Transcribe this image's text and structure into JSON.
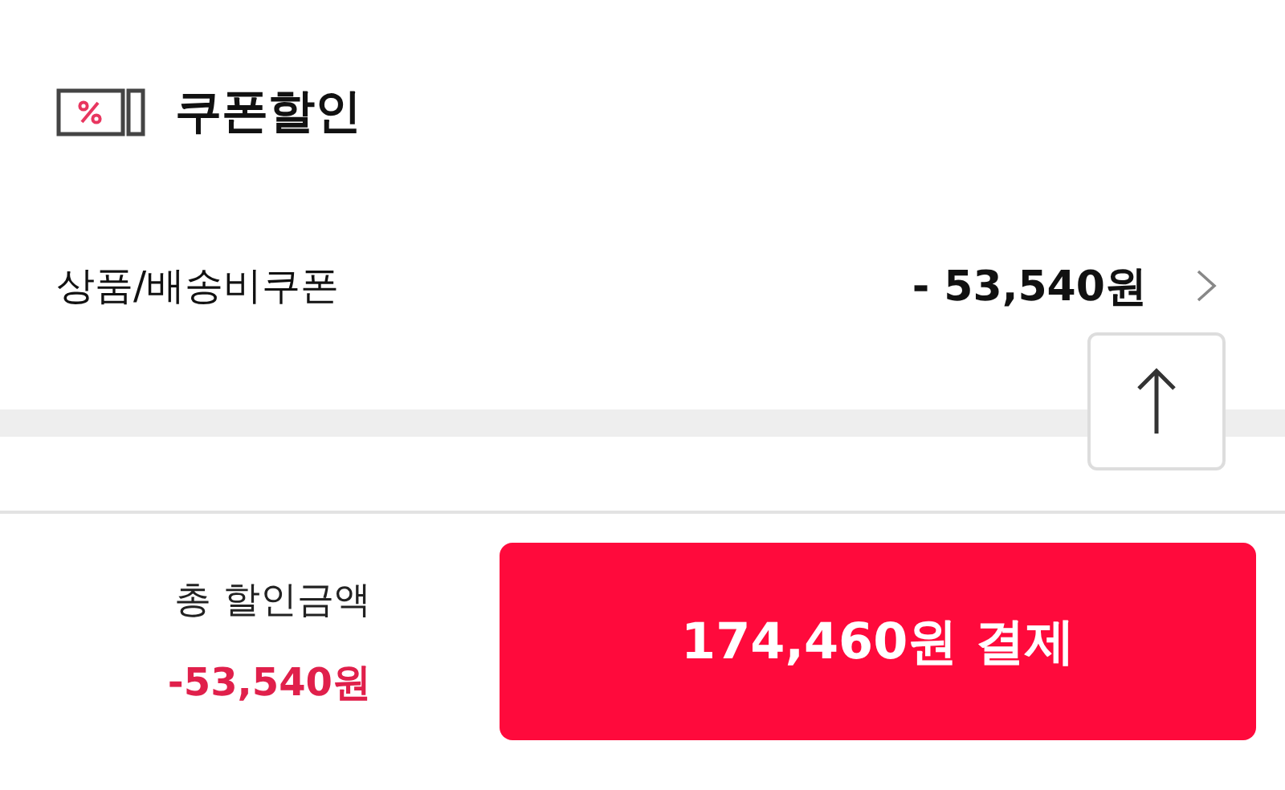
{
  "section": {
    "title": "쿠폰할인"
  },
  "coupon_row": {
    "label": "상품/배송비쿠폰",
    "amount": "- 53,540원"
  },
  "footer": {
    "total_label": "총 할인금액",
    "total_amount": "-53,540원",
    "pay_button": "174,460원 결제"
  }
}
